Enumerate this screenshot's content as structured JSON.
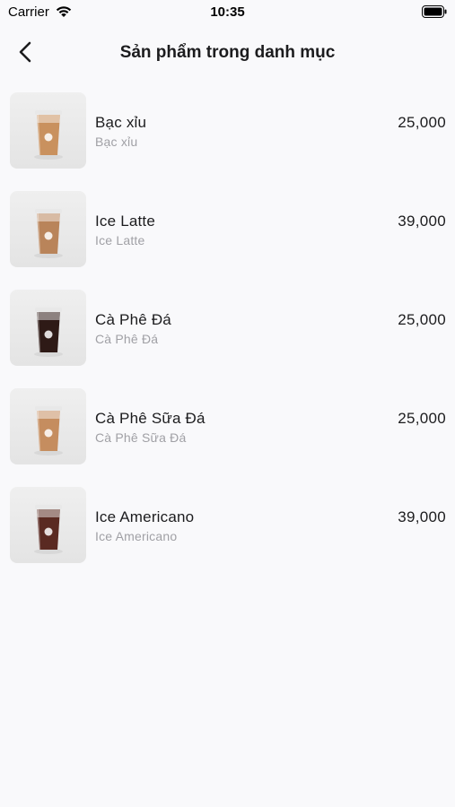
{
  "status_bar": {
    "carrier": "Carrier",
    "time": "10:35"
  },
  "nav": {
    "title": "Sản phẩm trong danh mục",
    "back_icon": "chevron-left-icon"
  },
  "products": [
    {
      "name": "Bạc xỉu",
      "subtitle": "Bạc xỉu",
      "price": "25,000",
      "drink_color": "#c9915e"
    },
    {
      "name": "Ice Latte",
      "subtitle": "Ice Latte",
      "price": "39,000",
      "drink_color": "#b9845a"
    },
    {
      "name": "Cà Phê Đá",
      "subtitle": "Cà Phê Đá",
      "price": "25,000",
      "drink_color": "#2e1a16"
    },
    {
      "name": "Cà Phê Sữa Đá",
      "subtitle": "Cà Phê Sữa Đá",
      "price": "25,000",
      "drink_color": "#c58d5f"
    },
    {
      "name": "Ice Americano",
      "subtitle": "Ice Americano",
      "price": "39,000",
      "drink_color": "#5a2a22"
    }
  ]
}
